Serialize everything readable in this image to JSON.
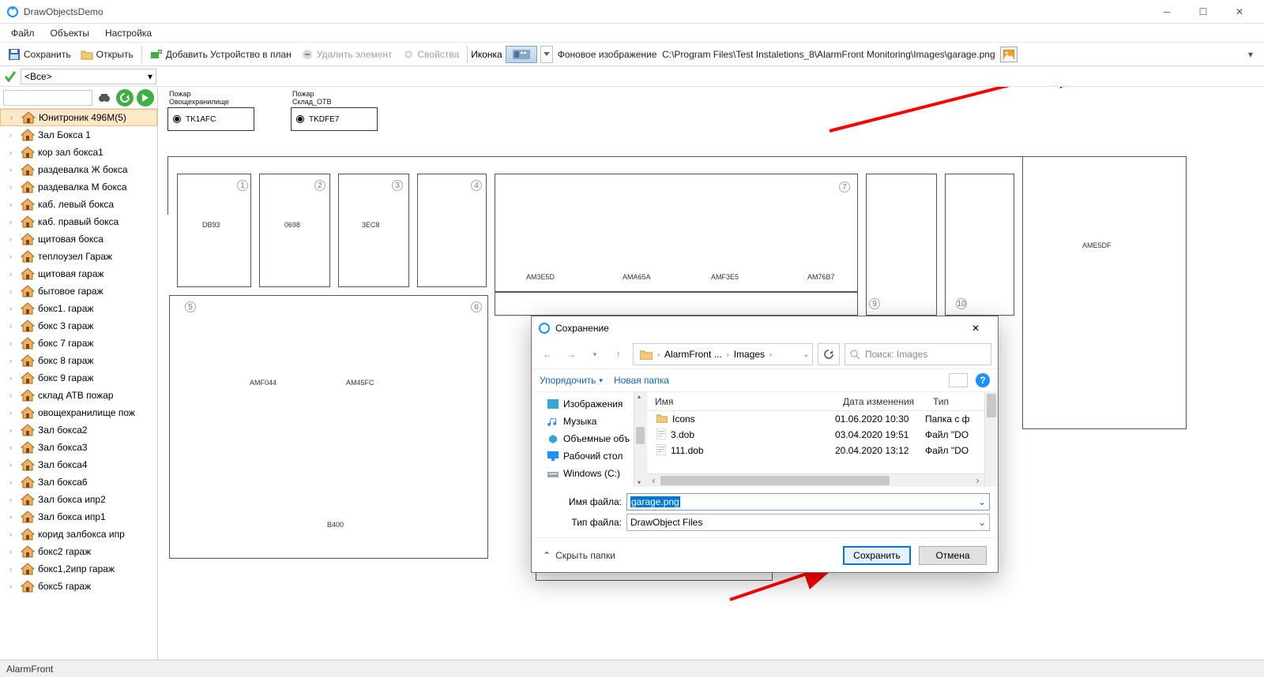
{
  "app": {
    "title": "DrawObjectsDemo"
  },
  "menubar": [
    "Файл",
    "Объекты",
    "Настройка"
  ],
  "toolbar": {
    "save": "Сохранить",
    "open": "Открыть",
    "add_device": "Добавить Устройство в план",
    "delete": "Удалить элемент",
    "props": "Свойства",
    "icon_label": "Иконка",
    "bg_label": "Фоновое изображение",
    "bg_path": "C:\\Program Files\\Test Instaletions_8\\AlarmFront Monitoring\\Images\\garage.png"
  },
  "filter": {
    "value": "<Все>"
  },
  "tree": {
    "items": [
      "Юнитроник 496М(5)",
      "Зал Бокса 1",
      "кор зал бокса1",
      "раздевалка Ж бокса",
      "раздевалка М бокса",
      "каб. левый бокса",
      "каб. правый бокса",
      "щитовая бокса",
      "теплоузел Гараж",
      "щитовая гараж",
      "бытовое гараж",
      "бокс1. гараж",
      "бокс 3 гараж",
      "бокс 7 гараж",
      "бокс 8 гараж",
      "бокс 9 гараж",
      "склад АТВ пожар",
      "овощехранилище пож",
      "Зал бокса2",
      "Зал бокса3",
      "Зал бокса4",
      "Зал бокса6",
      "Зал бокса ипр2",
      "Зал бокса ипр1",
      "корид залбокса ипр",
      "бокс2 гараж",
      "бокс1,2ипр гараж",
      "бокс5 гараж"
    ]
  },
  "devices": [
    {
      "title1": "Пожар",
      "title2": "Овощехранилище",
      "code": "TK1AFC"
    },
    {
      "title1": "Пожар",
      "title2": "Склад_ОТВ",
      "code": "TKDFE7"
    }
  ],
  "rooms": {
    "r1": "DB93",
    "r2": "0698",
    "r3": "3EC8",
    "am3e5d": "AM3E5D",
    "amA65a": "AMA65A",
    "amf3e5": "AMF3E5",
    "am76b7": "AM76B7",
    "amf044": "AMF044",
    "am45fc": "AM45FC",
    "b400": "B400",
    "ame5df": "AME5DF"
  },
  "dialog": {
    "title": "Сохранение",
    "crumbs": [
      "AlarmFront ...",
      "Images"
    ],
    "search_placeholder": "Поиск: Images",
    "organize": "Упорядочить",
    "new_folder": "Новая папка",
    "tree": [
      "Изображения",
      "Музыка",
      "Объемные объ",
      "Рабочий стол",
      "Windows (C:)"
    ],
    "cols": {
      "name": "Имя",
      "date": "Дата изменения",
      "type": "Тип"
    },
    "rows": [
      {
        "name": "Icons",
        "date": "01.06.2020 10:30",
        "type": "Папка с ф"
      },
      {
        "name": "3.dob",
        "date": "03.04.2020 19:51",
        "type": "Файл \"DO"
      },
      {
        "name": "111.dob",
        "date": "20.04.2020 13:12",
        "type": "Файл \"DO"
      }
    ],
    "file_label": "Имя файла:",
    "file_value": "garage.png",
    "type_label": "Тип файла:",
    "type_value": "DrawObject Files",
    "hide": "Скрыть папки",
    "save": "Сохранить",
    "cancel": "Отмена"
  },
  "status": "AlarmFront"
}
